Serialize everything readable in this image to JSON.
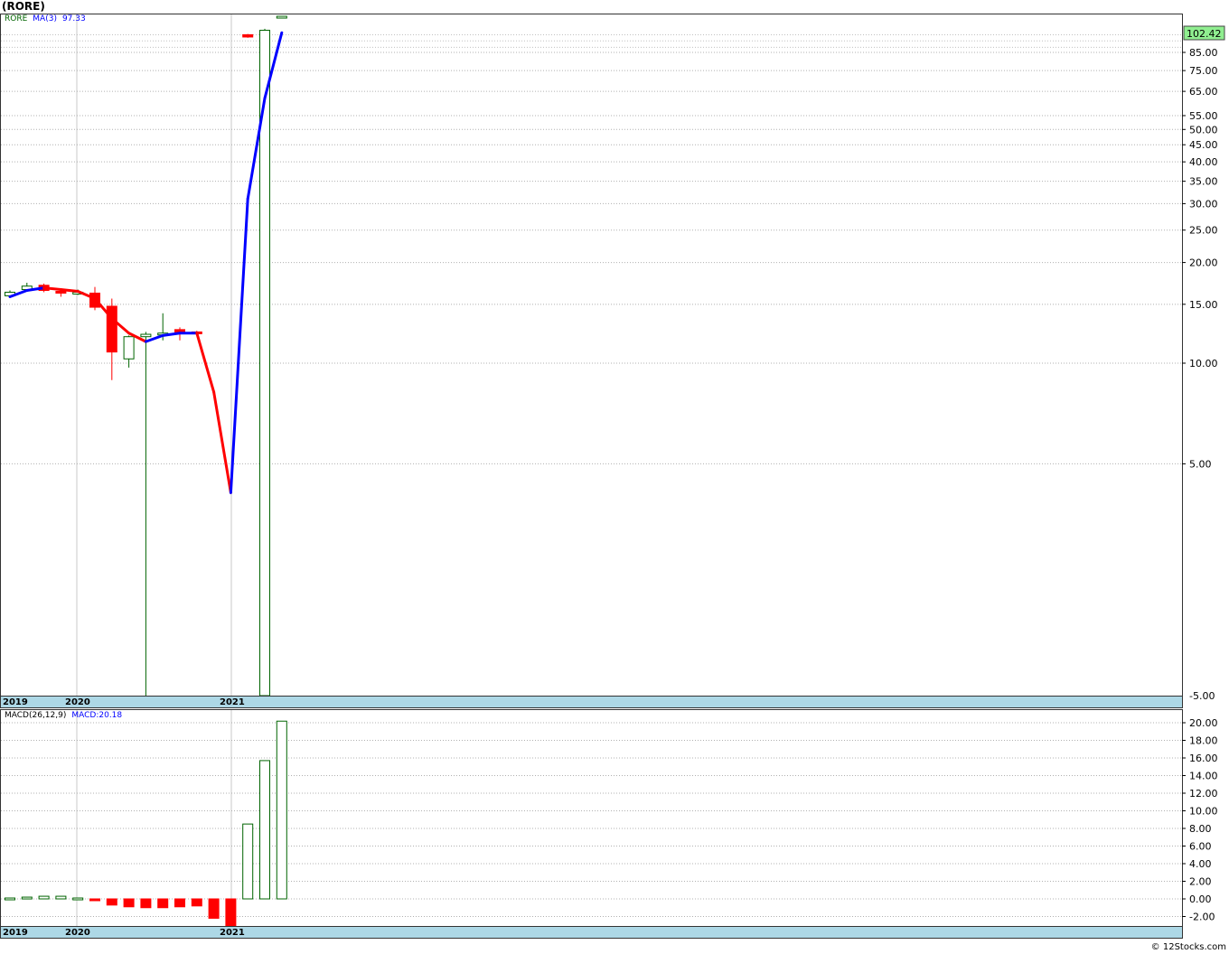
{
  "header": {
    "title": "(RORE)"
  },
  "price_panel": {
    "ticker": "RORE",
    "ma_label": "MA(3)",
    "ma_value": "97.33",
    "last_price_badge": "102.42",
    "date_labels": [
      "2019",
      "2020",
      "2021"
    ]
  },
  "macd_panel": {
    "label": "MACD(26,12,9)",
    "value_label": "MACD:20.18",
    "date_labels": [
      "2019",
      "2020",
      "2021"
    ]
  },
  "footer": {
    "credit": "© 12Stocks.com"
  },
  "colors": {
    "up": "#006400",
    "down": "#ff0000",
    "ma_up": "#0000ff",
    "ma_down": "#ff0000",
    "badge": "#90ee90",
    "date_bar": "#add8e6"
  },
  "chart_data": [
    {
      "type": "candlestick",
      "title": "(RORE)",
      "scale": "log",
      "y_tick_labels": [
        "102.42",
        "85.00",
        "75.00",
        "65.00",
        "55.00",
        "50.00",
        "45.00",
        "40.00",
        "35.00",
        "30.00",
        "25.00",
        "20.00",
        "15.00",
        "10.00",
        "5.00",
        "-5.00"
      ],
      "x_tick_labels": [
        "2019",
        "2020",
        "2021"
      ],
      "grid": true,
      "candles": [
        {
          "o": 15.9,
          "h": 16.5,
          "l": 15.7,
          "c": 16.3
        },
        {
          "o": 16.6,
          "h": 17.4,
          "l": 16.4,
          "c": 17.0
        },
        {
          "o": 17.1,
          "h": 17.3,
          "l": 16.3,
          "c": 16.5
        },
        {
          "o": 16.4,
          "h": 16.6,
          "l": 15.8,
          "c": 16.2
        },
        {
          "o": 16.3,
          "h": 16.6,
          "l": 16.0,
          "c": 16.3
        },
        {
          "o": 16.2,
          "h": 16.9,
          "l": 14.4,
          "c": 14.7
        },
        {
          "o": 14.8,
          "h": 15.6,
          "l": 8.9,
          "c": 10.8
        },
        {
          "o": 10.3,
          "h": 12.1,
          "l": 9.7,
          "c": 12.0
        },
        {
          "o": 12.0,
          "h": 12.4,
          "l": 0.8,
          "c": 12.2
        },
        {
          "o": 12.2,
          "h": 14.1,
          "l": 11.7,
          "c": 12.3
        },
        {
          "o": 12.6,
          "h": 12.8,
          "l": 11.7,
          "c": 12.4
        },
        {
          "o": 12.4,
          "h": 12.5,
          "l": 12.3,
          "c": 12.3
        },
        null,
        null,
        {
          "o": 96.0,
          "h": 96.5,
          "l": 94.0,
          "c": 94.5
        },
        {
          "o": 0.8,
          "h": 100.0,
          "l": 0.8,
          "c": 99.0
        },
        {
          "o": 109.0,
          "h": 109.0,
          "l": 109.0,
          "c": 109.0
        }
      ],
      "ma": [
        15.8,
        16.5,
        16.8,
        16.6,
        16.4,
        15.6,
        13.6,
        12.3,
        11.6,
        12.1,
        12.3,
        12.3,
        8.2,
        4.1,
        31.0,
        62.0,
        97.33
      ]
    },
    {
      "type": "bar",
      "title": "MACD(26,12,9)",
      "series": [
        {
          "name": "MACD",
          "values": [
            0.1,
            0.2,
            0.3,
            0.3,
            0.1,
            -0.2,
            -0.7,
            -0.9,
            -1.0,
            -1.0,
            -0.9,
            -0.8,
            -2.2,
            -3.2,
            8.5,
            15.7,
            20.18
          ]
        }
      ],
      "ylim": [
        -3.0,
        20.6
      ],
      "y_tick_labels": [
        "20.00",
        "18.00",
        "16.00",
        "14.00",
        "12.00",
        "10.00",
        "8.00",
        "6.00",
        "4.00",
        "2.00",
        "0.00",
        "-2.00"
      ],
      "x_tick_labels": [
        "2019",
        "2020",
        "2021"
      ],
      "grid": true
    }
  ]
}
